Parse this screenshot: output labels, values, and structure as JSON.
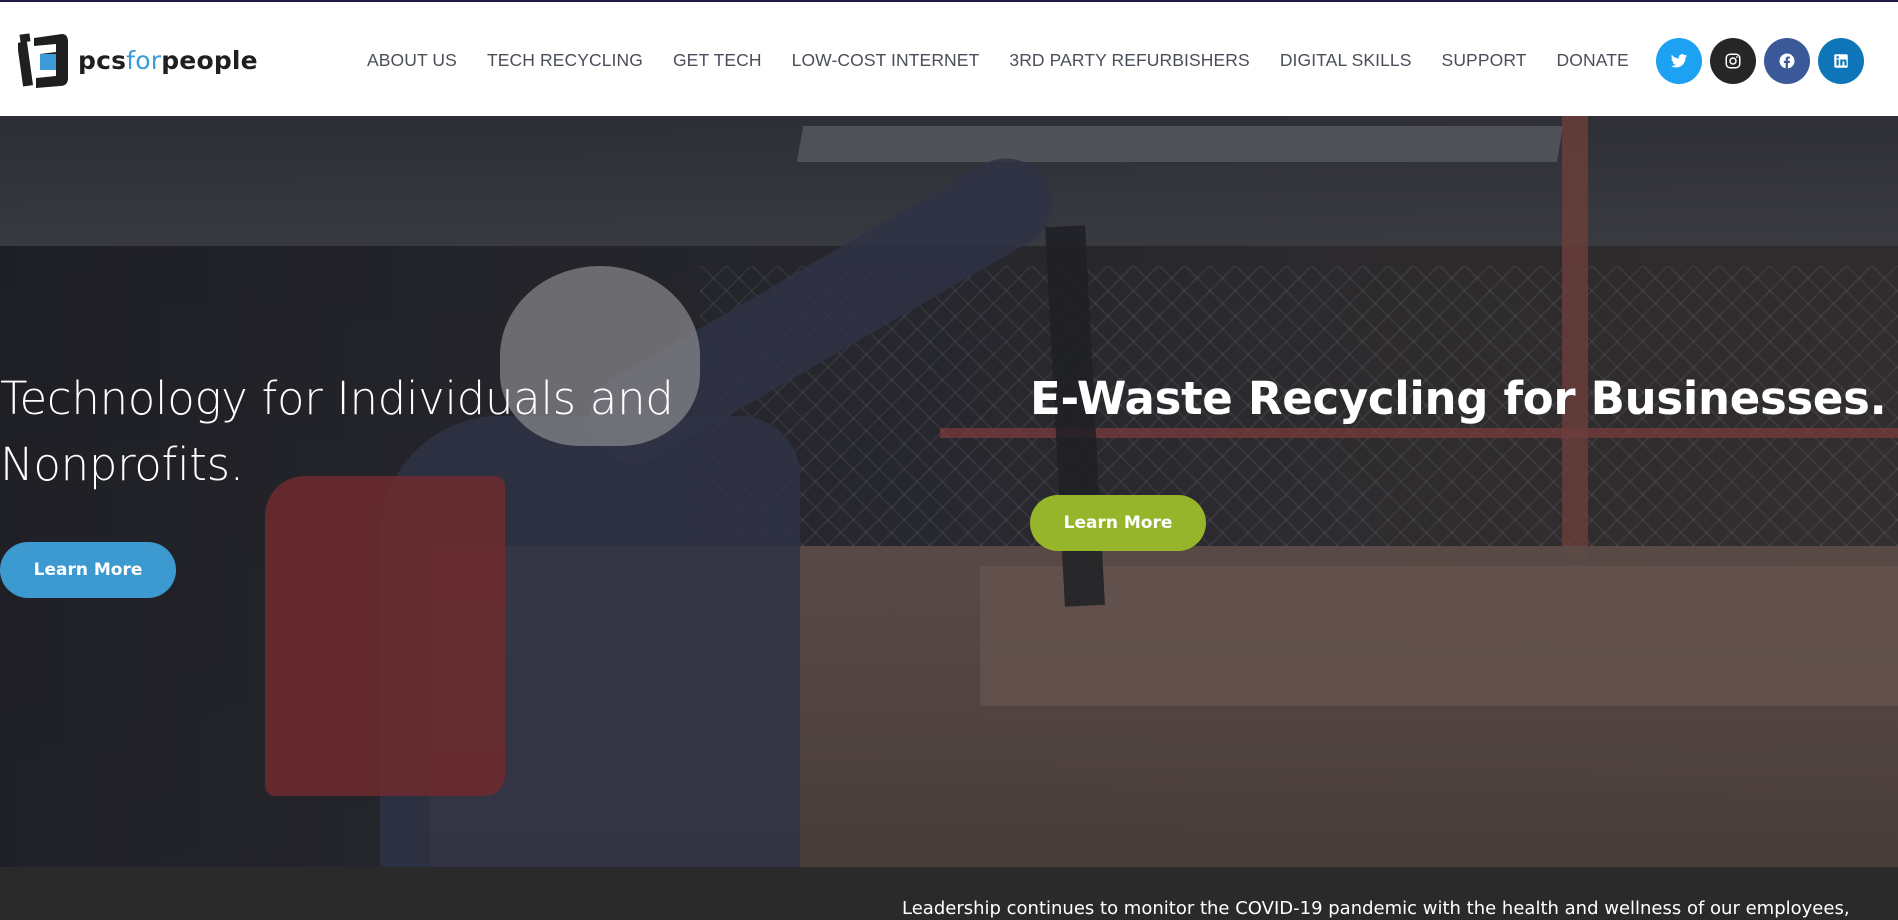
{
  "brand": {
    "name_part1": "pcs",
    "name_accent": "for",
    "name_part2": "people",
    "accent_color": "#3b9bd6"
  },
  "nav": {
    "items": [
      {
        "label": "ABOUT US"
      },
      {
        "label": "TECH RECYCLING"
      },
      {
        "label": "GET TECH"
      },
      {
        "label": "LOW-COST INTERNET"
      },
      {
        "label": "3RD PARTY REFURBISHERS"
      },
      {
        "label": "DIGITAL SKILLS"
      },
      {
        "label": "SUPPORT"
      },
      {
        "label": "DONATE"
      }
    ]
  },
  "social": [
    {
      "icon": "twitter-icon",
      "color": "#1da1f2"
    },
    {
      "icon": "instagram-icon",
      "color": "#262626"
    },
    {
      "icon": "facebook-icon",
      "color": "#3b5998"
    },
    {
      "icon": "linkedin-icon",
      "color": "#0e76b8"
    }
  ],
  "hero": {
    "left_heading": "Technology for Individuals and Nonprofits.",
    "left_button": "Learn More",
    "left_button_color": "#3d9ad1",
    "right_heading": "E-Waste Recycling for Businesses.",
    "right_button": "Learn More",
    "right_button_color": "#97b52a"
  },
  "notice": {
    "text": "Leadership continues to monitor the COVID-19 pandemic with the health and wellness of our employees,"
  }
}
